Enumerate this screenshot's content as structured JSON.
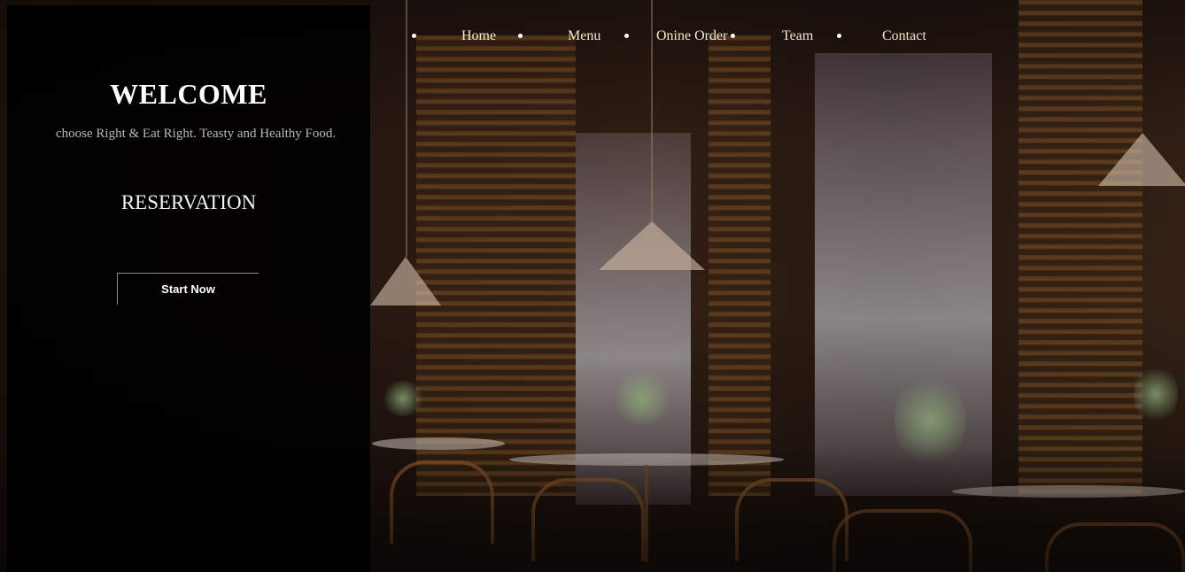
{
  "hero": {
    "title": "WELCOME",
    "tagline": "choose Right & Eat Right. Teasty and Healthy Food.",
    "reservation_heading": "RESERVATION",
    "cta_label": "Start Now"
  },
  "nav": {
    "items": [
      {
        "label": "Home"
      },
      {
        "label": "Menu"
      },
      {
        "label": "Onine Order"
      },
      {
        "label": "Team"
      },
      {
        "label": "Contact"
      }
    ]
  },
  "colors": {
    "panel": "#000000",
    "nav_text": "#f5e9cf",
    "tagline": "#b9b9b9"
  }
}
